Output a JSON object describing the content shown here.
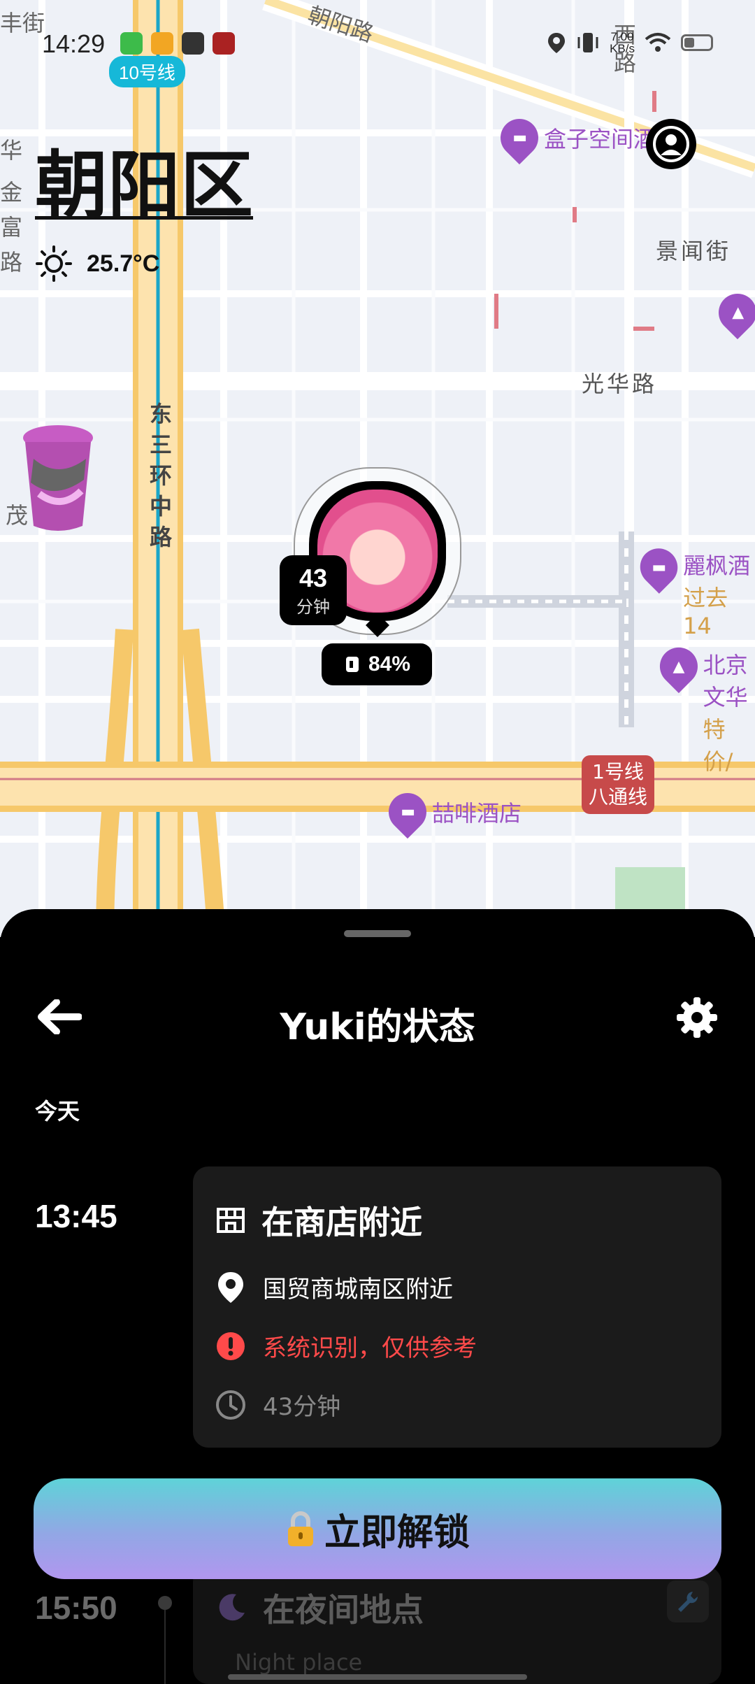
{
  "status_bar": {
    "time": "14:29",
    "net_speed_value": "7.00",
    "net_speed_unit": "KB/s"
  },
  "map": {
    "metro_line_badge": "10号线",
    "district": "朝阳区",
    "weather_temp": "25.7°C",
    "road_labels": {
      "chaoyang_road": "朝阳路",
      "east_third_ring": "东三环中路",
      "guanghua_road": "光华路",
      "jingwen_street": "景闻街",
      "fengjie": "丰街",
      "hua": "华",
      "jin": "金",
      "fu": "富",
      "lu": "路",
      "mao": "茂",
      "ximen": "西路"
    },
    "poi": {
      "hezi_hotel": "盒子空间酒店",
      "zhefei_hotel": "喆啡酒店",
      "lifeng_1": "麗枫酒",
      "lifeng_2": "过去14",
      "beijing_1": "北京",
      "beijing_2": "文华",
      "beijing_3": "特价/"
    },
    "line1_badge_1": "1号线",
    "line1_badge_2": "八通线",
    "duration_value": "43",
    "duration_unit": "分钟",
    "battery_level": "84%"
  },
  "sheet": {
    "title": "Yuki的状态",
    "day_label": "今天",
    "entries": [
      {
        "time": "13:45",
        "title": "在商店附近",
        "location": "国贸商城南区附近",
        "warning": "系统识别，仅供参考",
        "duration": "43分钟"
      },
      {
        "time": "15:50",
        "title": "在夜间地点",
        "subtitle": "Night place"
      }
    ],
    "unlock_label": "立即解锁"
  },
  "colors": {
    "accent_warning": "#ff4a4a",
    "poi_purple": "#9b52c4",
    "unlock_gradient_top": "#5ed3d8",
    "unlock_gradient_bottom": "#b196ef"
  }
}
